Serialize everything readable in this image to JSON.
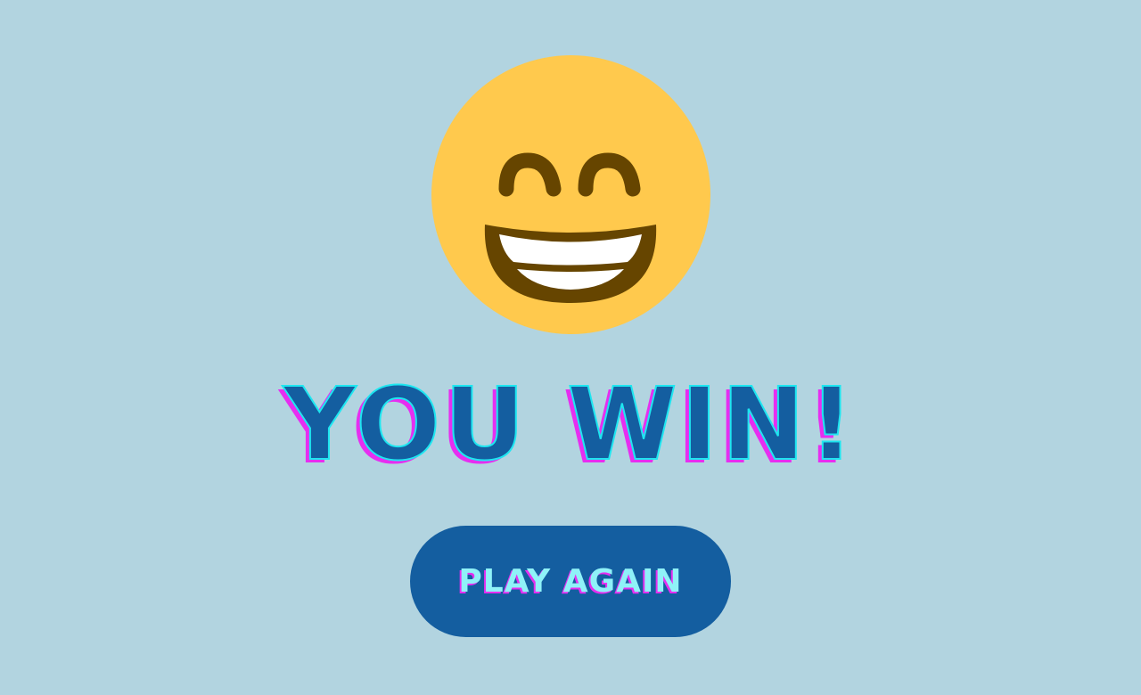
{
  "screen": {
    "title": "YOU WIN!",
    "emoji": "grinning-face-with-smiling-eyes-icon"
  },
  "actions": {
    "play_again_label": "PLAY AGAIN"
  },
  "colors": {
    "background": "#b2d4e0",
    "emoji_face": "#ffc94d",
    "emoji_features": "#664500",
    "title_fill": "#145ea0",
    "title_outline": "#1ee6f0",
    "title_shadow": "#e62ef0",
    "button_bg": "#145ea0",
    "button_text": "#8ff2f8"
  }
}
